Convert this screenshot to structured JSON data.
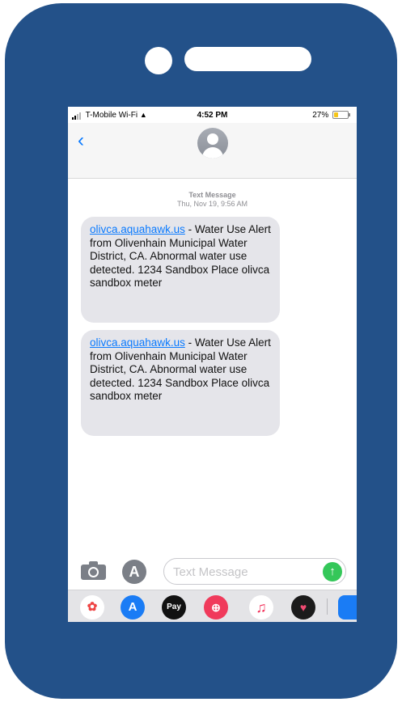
{
  "colors": {
    "phone_frame": "#235189",
    "bubble": "#e5e5ea",
    "link": "#0a7aff",
    "send": "#34c759",
    "battery": "#f5c518"
  },
  "status_bar": {
    "carrier": "T-Mobile Wi-Fi",
    "time": "4:52 PM",
    "battery_percent": "27%"
  },
  "header": {
    "back_icon": "chevron-left-icon",
    "back_glyph": "‹",
    "avatar_icon": "person-silhouette-icon"
  },
  "conversation": {
    "label": "Text Message",
    "timestamp": "Thu, Nov 19, 9:56 AM",
    "messages": [
      {
        "link": "olivca.aquahawk.us",
        "text": " - Water Use Alert from Olivenhain Municipal Water District, CA. Abnormal water use detected. 1234 Sandbox Place olivca sandbox meter"
      },
      {
        "link": "olivca.aquahawk.us",
        "text": " - Water Use Alert from Olivenhain Municipal Water District, CA. Abnormal water use detected. 1234 Sandbox Place olivca sandbox meter"
      }
    ]
  },
  "composer": {
    "camera_icon": "camera-icon",
    "apps_icon": "app-store-icon",
    "apps_glyph": "A",
    "placeholder": "Text Message",
    "value": "",
    "send_icon": "arrow-up-icon",
    "send_glyph": "↑"
  },
  "app_tray": [
    {
      "name": "photos-app-icon",
      "glyph": "✿"
    },
    {
      "name": "app-store-app-icon",
      "glyph": "A"
    },
    {
      "name": "apple-pay-app-icon",
      "glyph": "Pay"
    },
    {
      "name": "image-search-app-icon",
      "glyph": "⊕"
    },
    {
      "name": "music-app-icon",
      "glyph": "♫"
    },
    {
      "name": "heart-app-icon",
      "glyph": "♥"
    },
    {
      "name": "partial-app-icon",
      "glyph": ""
    }
  ]
}
